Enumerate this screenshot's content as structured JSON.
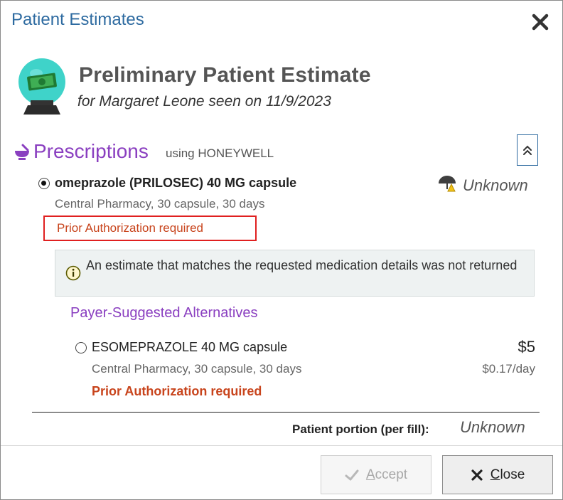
{
  "dialog": {
    "title": "Patient Estimates"
  },
  "header": {
    "title": "Preliminary Patient Estimate",
    "subtitle": "for Margaret Leone seen on 11/9/2023"
  },
  "prescriptions": {
    "title": "Prescriptions",
    "using": "using HONEYWELL",
    "selected_medication": {
      "name": "omeprazole (PRILOSEC) 40 MG capsule",
      "details": "Central Pharmacy, 30 capsule, 30 days",
      "authorization": "Prior Authorization required",
      "coverage_status": "Unknown",
      "selected": true
    },
    "info_message": "An estimate that matches the requested medication details was not returned",
    "alternatives_title": "Payer-Suggested Alternatives",
    "alternatives": [
      {
        "name": "ESOMEPRAZOLE 40 MG capsule",
        "details": "Central Pharmacy, 30 capsule, 30 days",
        "authorization": "Prior Authorization required",
        "price": "$5",
        "per_day": "$0.17/day",
        "selected": false
      }
    ]
  },
  "summary": {
    "portion_label": "Patient portion (per fill):",
    "portion_value": "Unknown"
  },
  "buttons": {
    "accept": "Accept",
    "close": "Close"
  },
  "colors": {
    "title_blue": "#2d6aa0",
    "section_purple": "#8a3fc0",
    "warning_orange": "#c8441c",
    "highlight_red": "#e02020"
  },
  "icons": {
    "header": "money-crystal-ball-icon",
    "prescriptions": "mortar-pestle-icon",
    "coverage": "umbrella-warning-icon",
    "info": "info-icon",
    "collapse": "double-chevron-up-icon",
    "close": "close-icon",
    "accept": "check-icon"
  }
}
